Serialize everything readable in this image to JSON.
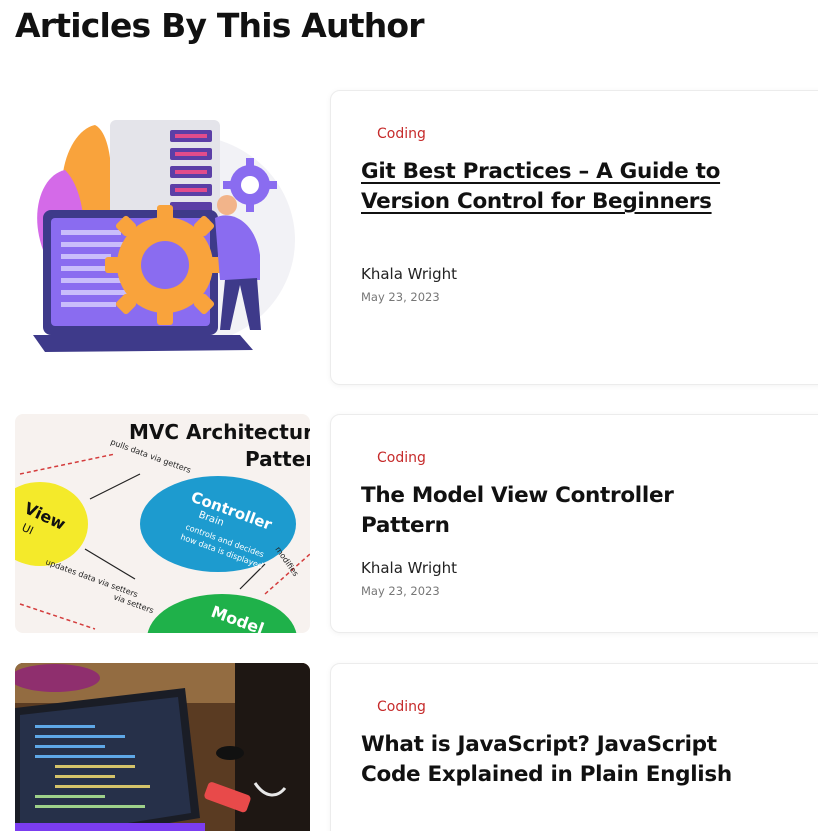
{
  "section": {
    "title": "Articles By This Author"
  },
  "articles": [
    {
      "category": "Coding",
      "title": "Git Best Practices – A Guide to Version Control for Beginners",
      "author": "Khala Wright",
      "date": "May 23, 2023",
      "image_icon": "server-gear-illustration"
    },
    {
      "category": "Coding",
      "title": "The Model View Controller Pattern",
      "author": "Khala Wright",
      "date": "May 23, 2023",
      "image_icon": "mvc-diagram",
      "image_text": {
        "heading_line1": "MVC Architectur",
        "heading_line2": "Patter",
        "view": "View",
        "view_sub": "UI",
        "controller": "Controller",
        "controller_sub": "Brain",
        "model": "Model"
      }
    },
    {
      "category": "Coding",
      "title": "What is JavaScript? JavaScript Code Explained in Plain English",
      "author": "",
      "date": "",
      "image_icon": "laptop-code-photo"
    }
  ],
  "colors": {
    "category": "#c62b2b",
    "laptop_purple": "#8a6cf0",
    "gear_orange": "#f9a33c",
    "mvc_yellow": "#f4ea2a",
    "mvc_blue": "#1d9bcf",
    "mvc_green": "#1fb14a"
  }
}
